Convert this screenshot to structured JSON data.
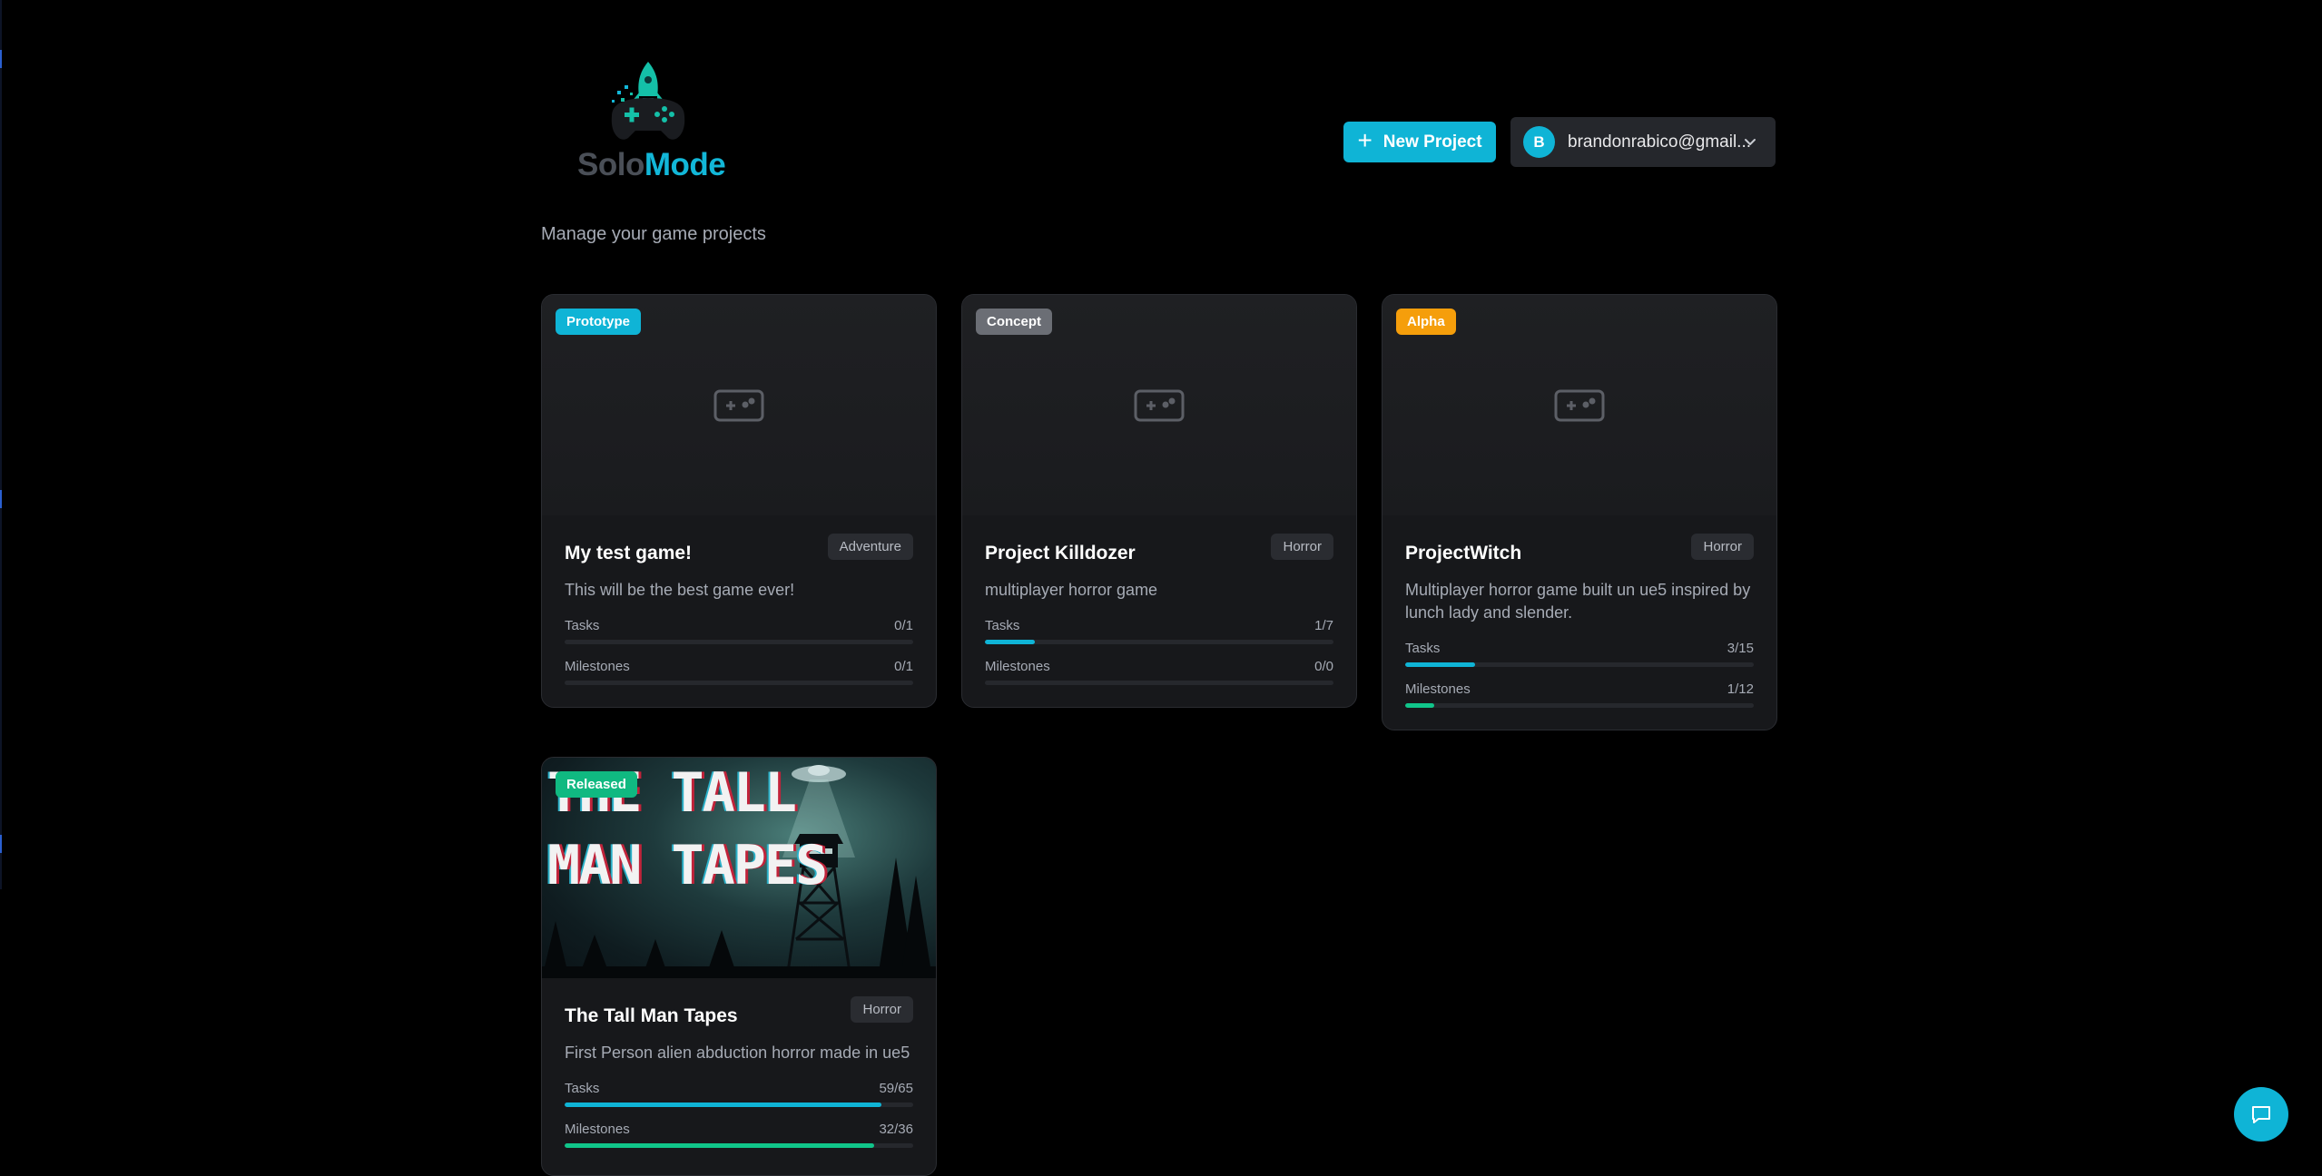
{
  "brand": {
    "name_part1": "Solo",
    "name_part2": "Mode"
  },
  "header": {
    "new_project_label": "New Project",
    "user": {
      "initial": "B",
      "email": "brandonrabico@gmail..."
    }
  },
  "page": {
    "subtitle": "Manage your game projects"
  },
  "labels": {
    "tasks": "Tasks",
    "milestones": "Milestones"
  },
  "colors": {
    "accent": "#0fb4d6",
    "milestone": "#10c58a",
    "status_prototype": "#0fb4d6",
    "status_concept": "#6b6e75",
    "status_alpha": "#f59e0b",
    "status_released": "#10b981"
  },
  "projects": [
    {
      "status": "Prototype",
      "title": "My test game!",
      "genre": "Adventure",
      "description": "This will be the best game ever!",
      "tasks": "0/1",
      "tasks_progress": 0,
      "milestones": "0/1",
      "milestones_progress": 0
    },
    {
      "status": "Concept",
      "title": "Project Killdozer",
      "genre": "Horror",
      "description": "multiplayer horror game",
      "tasks": "1/7",
      "tasks_progress": 0.143,
      "milestones": "0/0",
      "milestones_progress": 0
    },
    {
      "status": "Alpha",
      "title": "ProjectWitch",
      "genre": "Horror",
      "description": "Multiplayer horror game built un ue5 inspired by lunch lady and slender.",
      "tasks": "3/15",
      "tasks_progress": 0.2,
      "milestones": "1/12",
      "milestones_progress": 0.083
    },
    {
      "status": "Released",
      "title": "The Tall Man Tapes",
      "genre": "Horror",
      "description": "First Person alien abduction horror made in ue5",
      "tasks": "59/65",
      "tasks_progress": 0.908,
      "milestones": "32/36",
      "milestones_progress": 0.889,
      "cover_text_line1": "THE TALL",
      "cover_text_line2": "MAN TAPES"
    }
  ]
}
